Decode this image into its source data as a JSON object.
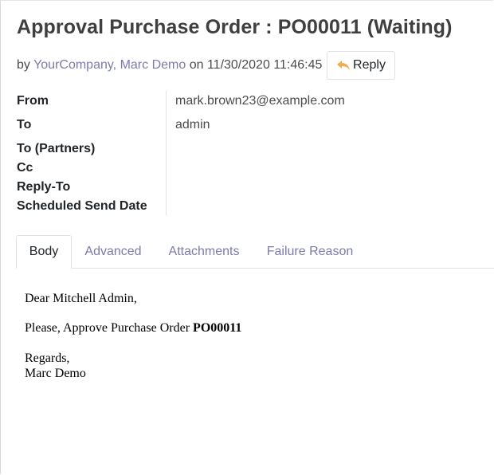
{
  "title": "Approval Purchase Order : PO00011 (Waiting)",
  "byline": {
    "prefix": "by",
    "author": "YourCompany, Marc Demo",
    "on": "on",
    "date": "11/30/2020 11:46:45"
  },
  "reply_label": "Reply",
  "colors": {
    "link": "#7c7bad",
    "reply_icon": "#f0ad4e"
  },
  "fields": [
    {
      "label": "From",
      "value": "mark.brown23@example.com"
    },
    {
      "label": "To",
      "value": "admin"
    },
    {
      "label": "To (Partners)",
      "value": ""
    },
    {
      "label": "Cc",
      "value": ""
    },
    {
      "label": "Reply-To",
      "value": ""
    },
    {
      "label": "Scheduled Send Date",
      "value": ""
    }
  ],
  "tabs": [
    "Body",
    "Advanced",
    "Attachments",
    "Failure Reason"
  ],
  "active_tab": "Body",
  "body": {
    "greeting": "Dear Mitchell Admin,",
    "line_prefix": "Please, Approve Purchase Order",
    "po_number": "PO00011",
    "closing": "Regards,",
    "signature": "Marc Demo"
  }
}
